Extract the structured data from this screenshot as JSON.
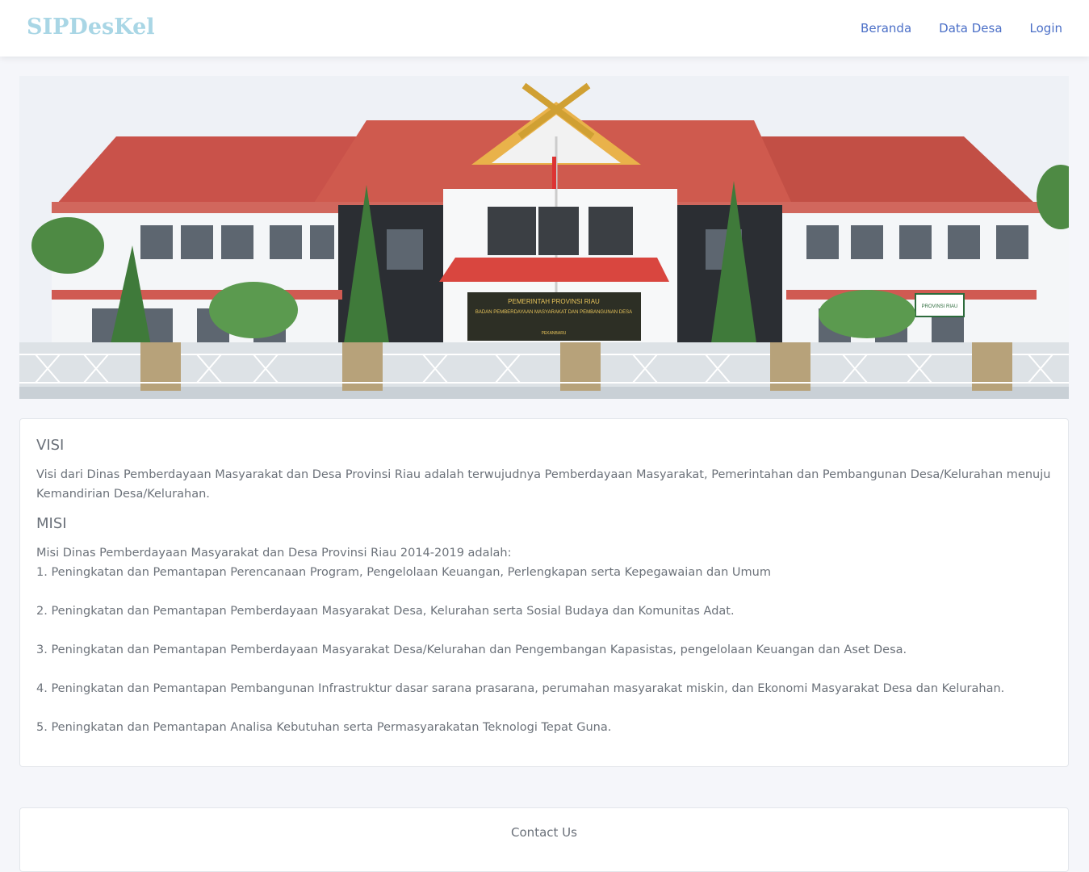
{
  "navbar": {
    "brand": "SIPDesKel",
    "links": [
      "Beranda",
      "Data Desa",
      "Login"
    ]
  },
  "hero": {
    "sign_title": "PEMERINTAH PROVINSI RIAU",
    "sign_subtitle": "BADAN PEMBERDAYAAN MASYARAKAT DAN PEMBANGUNAN DESA",
    "sign_city": "PEKANBARU",
    "side_sign": "PROVINSI RIAU"
  },
  "visi": {
    "title": "VISI",
    "text": "Visi dari Dinas Pemberdayaan Masyarakat dan Desa Provinsi Riau adalah terwujudnya Pemberdayaan Masyarakat, Pemerintahan dan Pembangunan Desa/Kelurahan menuju Kemandirian Desa/Kelurahan."
  },
  "misi": {
    "title": "MISI",
    "intro": "Misi Dinas Pemberdayaan Masyarakat dan Desa Provinsi Riau 2014-2019 adalah:",
    "items": [
      "1. Peningkatan dan Pemantapan Perencanaan Program, Pengelolaan Keuangan, Perlengkapan serta Kepegawaian dan Umum",
      "2. Peningkatan dan Pemantapan Pemberdayaan Masyarakat Desa, Kelurahan serta Sosial Budaya dan Komunitas Adat.",
      "3. Peningkatan dan Pemantapan Pemberdayaan Masyarakat Desa/Kelurahan dan Pengembangan Kapasistas, pengelolaan Keuangan dan Aset Desa.",
      "4. Peningkatan dan Pemantapan Pembangunan Infrastruktur dasar sarana prasarana, perumahan masyarakat miskin, dan Ekonomi Masyarakat Desa dan Kelurahan.",
      "5. Peningkatan dan Pemantapan Analisa Kebutuhan serta Permasyarakatan Teknologi Tepat Guna."
    ]
  },
  "footer": {
    "text": "Contact Us"
  },
  "colors": {
    "brand": "#a9d6e5",
    "nav_link": "#4b6fc7",
    "roof": "#c84a3e"
  }
}
